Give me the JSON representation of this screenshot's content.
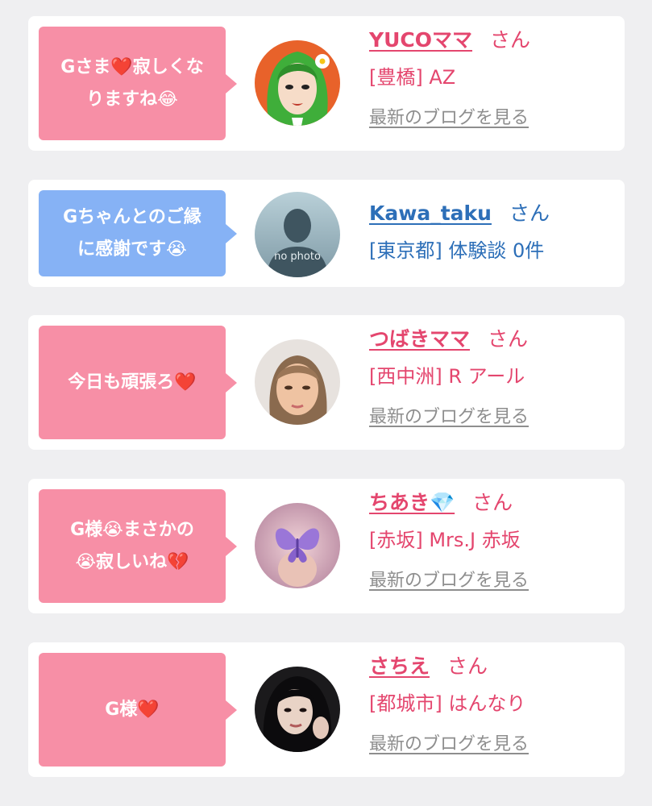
{
  "colors": {
    "pink": "#f78fa6",
    "blue": "#86b2f5",
    "name_pink": "#e4466e",
    "name_blue": "#2d6fb8",
    "link_gray": "#8e8e8e"
  },
  "blog_link_label": "最新のブログを見る",
  "honorific": "さん",
  "items": [
    {
      "message_lines": [
        "Gさま❤️寂しくな",
        "りますね😂"
      ],
      "bubble_color": "pink",
      "name": "YUCOママ",
      "meta": "[豊橋] AZ",
      "avatar_icon": "green-hair-cartoon-avatar"
    },
    {
      "message_lines": [
        "Gちゃんとのご縁",
        "に感謝です😭"
      ],
      "bubble_color": "blue",
      "name": "Kawa_taku",
      "meta": "[東京都] 体験談 0件",
      "avatar_icon": "no-photo-silhouette-icon",
      "avatar_text": "no photo"
    },
    {
      "message_lines": [
        "今日も頑張ろ❤️"
      ],
      "bubble_color": "pink",
      "name": "つばきママ",
      "meta": "[西中洲] R アール",
      "avatar_icon": "blurred-face-photo"
    },
    {
      "message_lines": [
        "G様😭まさかの",
        "😭寂しいね💔"
      ],
      "bubble_color": "pink",
      "name": "ちあき💎",
      "meta": "[赤坂] Mrs.J 赤坂",
      "avatar_icon": "butterfly-photo"
    },
    {
      "message_lines": [
        "G様❤️"
      ],
      "bubble_color": "pink",
      "name": "さちえ",
      "meta": "[都城市] はんなり",
      "avatar_icon": "dark-hair-portrait-photo"
    }
  ]
}
